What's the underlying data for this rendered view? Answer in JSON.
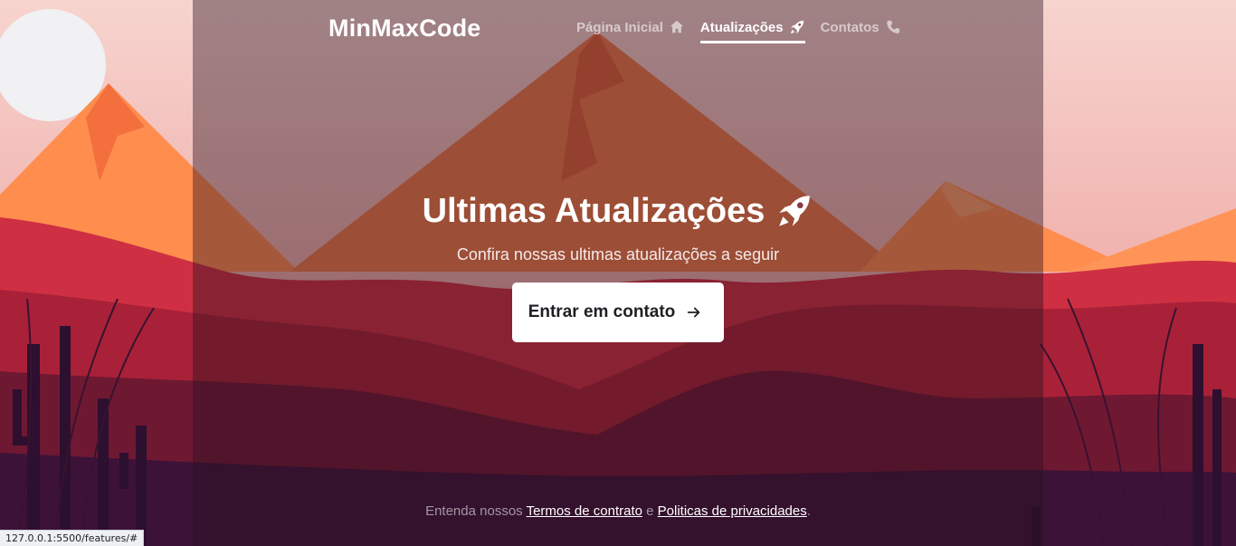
{
  "header": {
    "brand": "MinMaxCode",
    "nav": [
      {
        "label": "Página Inicial",
        "icon": "home-icon",
        "active": false
      },
      {
        "label": "Atualizações",
        "icon": "rocket-icon",
        "active": true
      },
      {
        "label": "Contatos",
        "icon": "phone-icon",
        "active": false
      }
    ]
  },
  "hero": {
    "title": "Ultimas Atualizações",
    "title_icon": "rocket-icon",
    "subtitle": "Confira nossas ultimas atualizações a seguir",
    "cta_label": "Entrar em contato",
    "cta_icon": "arrow-right-icon"
  },
  "footer": {
    "prefix": "Entenda nossos ",
    "terms_label": "Termos de contrato",
    "joiner": " e ",
    "privacy_label": "Politicas de privacidades",
    "suffix": "."
  },
  "status_bar": {
    "url": "127.0.0.1:5500/features/#"
  },
  "colors": {
    "overlay": "#281020",
    "button_bg": "#ffffff",
    "button_text": "#1f1f24",
    "nav_active": "#ffffff",
    "sky_top": "#f6d2c8",
    "mountain_orange": "#ff8a4c",
    "hill_red": "#c5283e",
    "hill_dark": "#7d1a33",
    "foreground": "#3a1438"
  }
}
